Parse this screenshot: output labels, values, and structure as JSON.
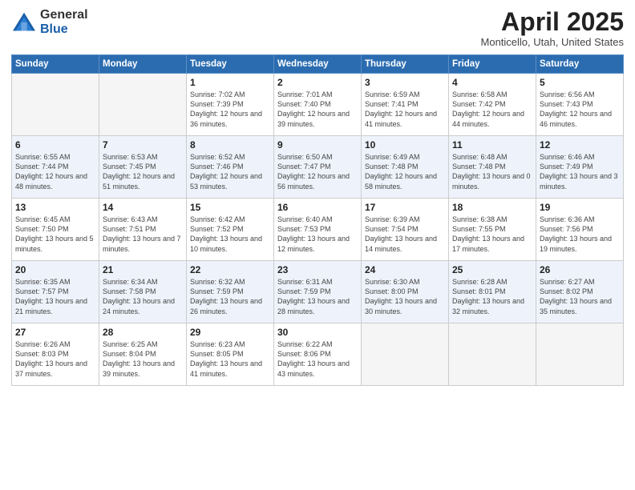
{
  "logo": {
    "general": "General",
    "blue": "Blue"
  },
  "header": {
    "title": "April 2025",
    "subtitle": "Monticello, Utah, United States"
  },
  "days_of_week": [
    "Sunday",
    "Monday",
    "Tuesday",
    "Wednesday",
    "Thursday",
    "Friday",
    "Saturday"
  ],
  "weeks": [
    [
      {
        "day": "",
        "info": ""
      },
      {
        "day": "",
        "info": ""
      },
      {
        "day": "1",
        "info": "Sunrise: 7:02 AM\nSunset: 7:39 PM\nDaylight: 12 hours and 36 minutes."
      },
      {
        "day": "2",
        "info": "Sunrise: 7:01 AM\nSunset: 7:40 PM\nDaylight: 12 hours and 39 minutes."
      },
      {
        "day": "3",
        "info": "Sunrise: 6:59 AM\nSunset: 7:41 PM\nDaylight: 12 hours and 41 minutes."
      },
      {
        "day": "4",
        "info": "Sunrise: 6:58 AM\nSunset: 7:42 PM\nDaylight: 12 hours and 44 minutes."
      },
      {
        "day": "5",
        "info": "Sunrise: 6:56 AM\nSunset: 7:43 PM\nDaylight: 12 hours and 46 minutes."
      }
    ],
    [
      {
        "day": "6",
        "info": "Sunrise: 6:55 AM\nSunset: 7:44 PM\nDaylight: 12 hours and 48 minutes."
      },
      {
        "day": "7",
        "info": "Sunrise: 6:53 AM\nSunset: 7:45 PM\nDaylight: 12 hours and 51 minutes."
      },
      {
        "day": "8",
        "info": "Sunrise: 6:52 AM\nSunset: 7:46 PM\nDaylight: 12 hours and 53 minutes."
      },
      {
        "day": "9",
        "info": "Sunrise: 6:50 AM\nSunset: 7:47 PM\nDaylight: 12 hours and 56 minutes."
      },
      {
        "day": "10",
        "info": "Sunrise: 6:49 AM\nSunset: 7:48 PM\nDaylight: 12 hours and 58 minutes."
      },
      {
        "day": "11",
        "info": "Sunrise: 6:48 AM\nSunset: 7:48 PM\nDaylight: 13 hours and 0 minutes."
      },
      {
        "day": "12",
        "info": "Sunrise: 6:46 AM\nSunset: 7:49 PM\nDaylight: 13 hours and 3 minutes."
      }
    ],
    [
      {
        "day": "13",
        "info": "Sunrise: 6:45 AM\nSunset: 7:50 PM\nDaylight: 13 hours and 5 minutes."
      },
      {
        "day": "14",
        "info": "Sunrise: 6:43 AM\nSunset: 7:51 PM\nDaylight: 13 hours and 7 minutes."
      },
      {
        "day": "15",
        "info": "Sunrise: 6:42 AM\nSunset: 7:52 PM\nDaylight: 13 hours and 10 minutes."
      },
      {
        "day": "16",
        "info": "Sunrise: 6:40 AM\nSunset: 7:53 PM\nDaylight: 13 hours and 12 minutes."
      },
      {
        "day": "17",
        "info": "Sunrise: 6:39 AM\nSunset: 7:54 PM\nDaylight: 13 hours and 14 minutes."
      },
      {
        "day": "18",
        "info": "Sunrise: 6:38 AM\nSunset: 7:55 PM\nDaylight: 13 hours and 17 minutes."
      },
      {
        "day": "19",
        "info": "Sunrise: 6:36 AM\nSunset: 7:56 PM\nDaylight: 13 hours and 19 minutes."
      }
    ],
    [
      {
        "day": "20",
        "info": "Sunrise: 6:35 AM\nSunset: 7:57 PM\nDaylight: 13 hours and 21 minutes."
      },
      {
        "day": "21",
        "info": "Sunrise: 6:34 AM\nSunset: 7:58 PM\nDaylight: 13 hours and 24 minutes."
      },
      {
        "day": "22",
        "info": "Sunrise: 6:32 AM\nSunset: 7:59 PM\nDaylight: 13 hours and 26 minutes."
      },
      {
        "day": "23",
        "info": "Sunrise: 6:31 AM\nSunset: 7:59 PM\nDaylight: 13 hours and 28 minutes."
      },
      {
        "day": "24",
        "info": "Sunrise: 6:30 AM\nSunset: 8:00 PM\nDaylight: 13 hours and 30 minutes."
      },
      {
        "day": "25",
        "info": "Sunrise: 6:28 AM\nSunset: 8:01 PM\nDaylight: 13 hours and 32 minutes."
      },
      {
        "day": "26",
        "info": "Sunrise: 6:27 AM\nSunset: 8:02 PM\nDaylight: 13 hours and 35 minutes."
      }
    ],
    [
      {
        "day": "27",
        "info": "Sunrise: 6:26 AM\nSunset: 8:03 PM\nDaylight: 13 hours and 37 minutes."
      },
      {
        "day": "28",
        "info": "Sunrise: 6:25 AM\nSunset: 8:04 PM\nDaylight: 13 hours and 39 minutes."
      },
      {
        "day": "29",
        "info": "Sunrise: 6:23 AM\nSunset: 8:05 PM\nDaylight: 13 hours and 41 minutes."
      },
      {
        "day": "30",
        "info": "Sunrise: 6:22 AM\nSunset: 8:06 PM\nDaylight: 13 hours and 43 minutes."
      },
      {
        "day": "",
        "info": ""
      },
      {
        "day": "",
        "info": ""
      },
      {
        "day": "",
        "info": ""
      }
    ]
  ]
}
